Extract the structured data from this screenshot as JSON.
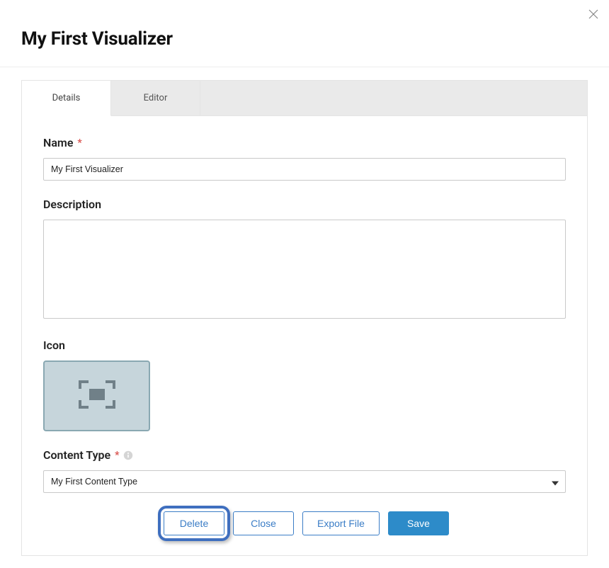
{
  "title": "My First Visualizer",
  "tabs": {
    "details": "Details",
    "editor": "Editor"
  },
  "labels": {
    "name": "Name",
    "description": "Description",
    "icon": "Icon",
    "contentType": "Content Type"
  },
  "required_marker": "*",
  "fields": {
    "name_value": "My First Visualizer",
    "description_value": "",
    "contentType_value": "My First Content Type"
  },
  "buttons": {
    "delete": "Delete",
    "close": "Close",
    "exportFile": "Export File",
    "save": "Save"
  }
}
